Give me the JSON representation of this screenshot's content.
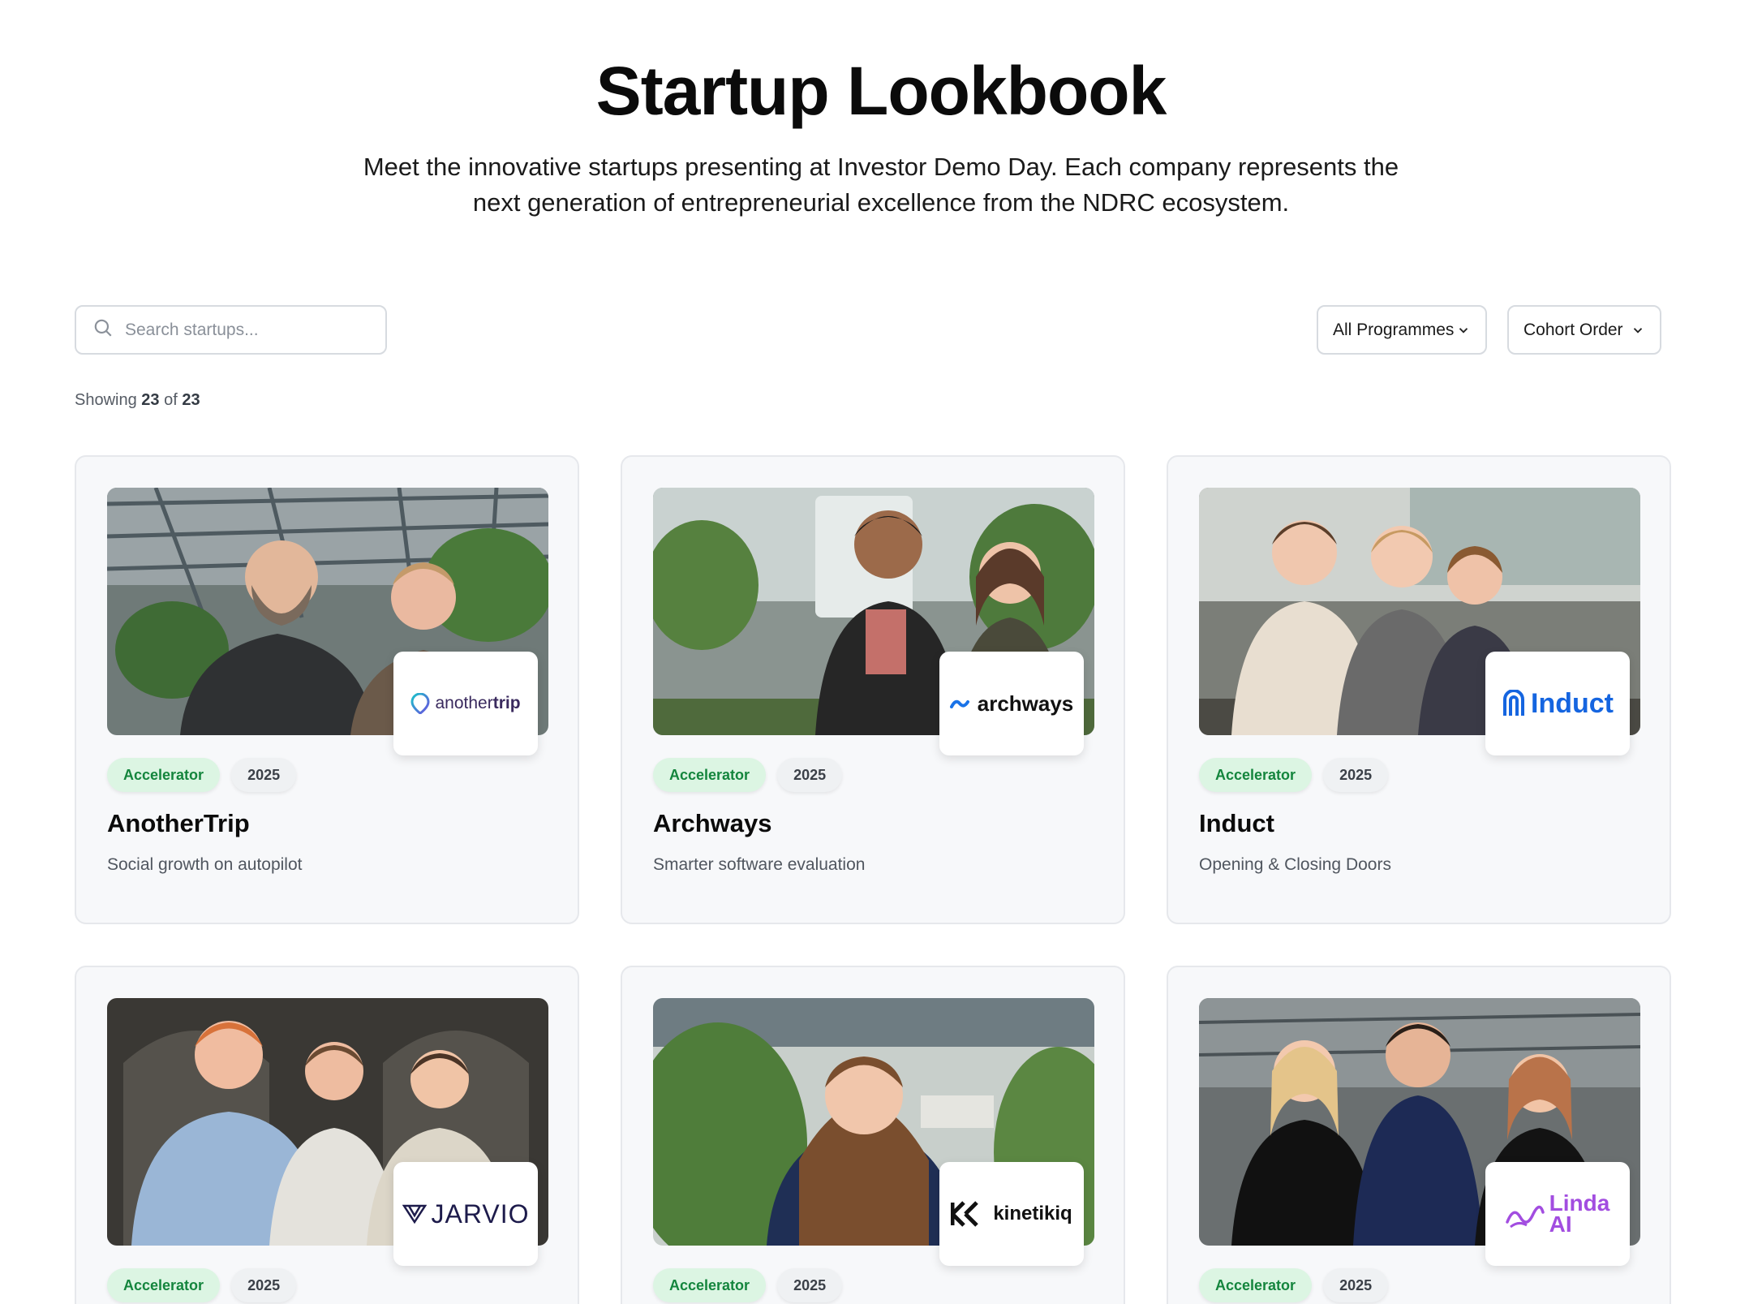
{
  "header": {
    "title": "Startup Lookbook",
    "subtitle": "Meet the innovative startups presenting at Investor Demo Day. Each company represents the next generation of entrepreneurial excellence from the NDRC ecosystem."
  },
  "filters": {
    "search_placeholder": "Search startups...",
    "programme_select": "All Programmes",
    "order_select": "Cohort Order"
  },
  "results": {
    "showing_label": "Showing",
    "shown": "23",
    "of_label": "of",
    "total": "23"
  },
  "startups": [
    {
      "name": "AnotherTrip",
      "tagline": "Social growth on autopilot",
      "programme": "Accelerator",
      "year": "2025",
      "logo": {
        "parts": [
          "another",
          "trip"
        ],
        "icon": "location-pin-icon",
        "color": "#3a2a5e"
      }
    },
    {
      "name": "Archways",
      "tagline": "Smarter software evaluation",
      "programme": "Accelerator",
      "year": "2025",
      "logo": {
        "text": "archways",
        "icon": "wave-icon",
        "color": "#111111",
        "icon_color": "#1a73e8"
      }
    },
    {
      "name": "Induct",
      "tagline": "Opening & Closing Doors",
      "programme": "Accelerator",
      "year": "2025",
      "logo": {
        "text": "Induct",
        "icon": "magnet-icon",
        "color": "#1565e0"
      }
    },
    {
      "name": "",
      "tagline": "",
      "programme": "Accelerator",
      "year": "2025",
      "logo": {
        "text": "JARVIO",
        "icon": "v-mark-icon",
        "color": "#1d1b4b"
      }
    },
    {
      "name": "",
      "tagline": "",
      "programme": "Accelerator",
      "year": "2025",
      "logo": {
        "text": "kinetikiq",
        "icon": "k-mark-icon",
        "color": "#111111"
      }
    },
    {
      "name": "",
      "tagline": "",
      "programme": "Accelerator",
      "year": "2025",
      "logo": {
        "parts": [
          "Linda",
          "AI"
        ],
        "icon": "squiggle-icon",
        "color": "#a24de0"
      }
    }
  ],
  "colors": {
    "accent_green_bg": "#dcf5e3",
    "accent_green_text": "#14853d",
    "card_bg": "#f7f8fa"
  }
}
